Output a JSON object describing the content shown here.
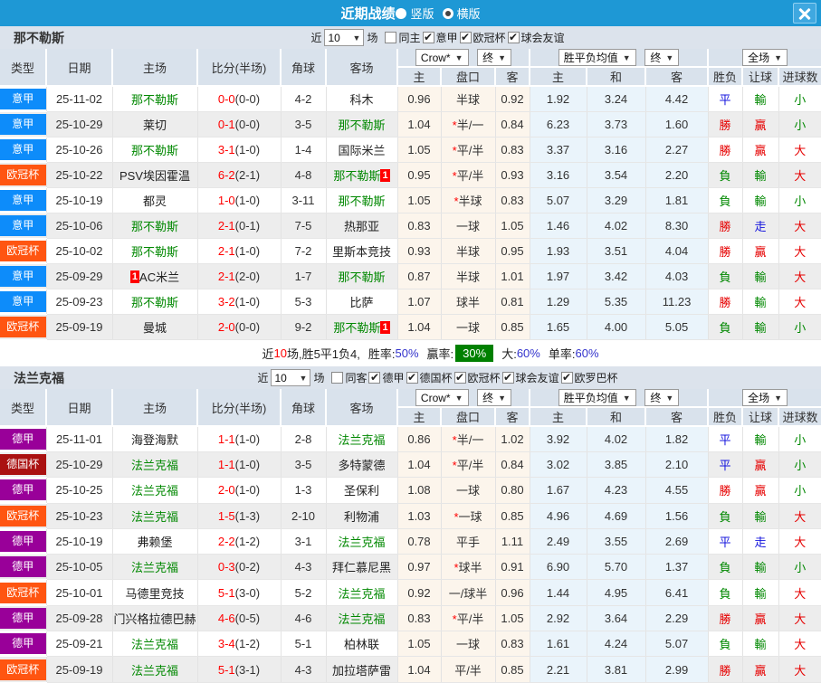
{
  "title_bar": {
    "title": "近期战绩",
    "layout_vertical": "竖版",
    "layout_horizontal": "横版",
    "selected_layout": "横版"
  },
  "columns": {
    "type": "类型",
    "date": "日期",
    "home": "主场",
    "score": "比分(半场)",
    "corner": "角球",
    "away": "客场",
    "asia_home": "主",
    "asia_pan": "盘口",
    "asia_away": "客",
    "eu_home": "主",
    "eu_draw": "和",
    "eu_away": "客",
    "res_wdl": "胜负",
    "res_pan": "让球",
    "res_goal": "进球数",
    "dd_crow": "Crow*",
    "dd_final": "终",
    "dd_avg": "胜平负均值",
    "dd_final2": "终",
    "dd_full": "全场"
  },
  "league_colors": {
    "意甲": "#0D8CFA",
    "欧冠杯": "#FF5511",
    "德甲": "#990099",
    "德国杯": "#AA1111"
  },
  "sections": [
    {
      "team": "那不勒斯",
      "filter": {
        "near": "近",
        "count": "10",
        "unit": "场",
        "same_label": "同主",
        "same_checked": false,
        "leagues": [
          "意甲",
          "欧冠杯",
          "球会友谊"
        ]
      },
      "rows": [
        {
          "league": "意甲",
          "date": "25-11-02",
          "home": "那不勒斯",
          "home_green": true,
          "home_badge": null,
          "score": "0-0",
          "half": "(0-0)",
          "corners": "4-2",
          "away": "科木",
          "away_green": false,
          "away_badge": null,
          "asia": [
            "0.96",
            "半球",
            "0.92"
          ],
          "asia_star": false,
          "europe": [
            "1.92",
            "3.24",
            "4.42"
          ],
          "results": [
            "平",
            "輸",
            "小"
          ]
        },
        {
          "league": "意甲",
          "date": "25-10-29",
          "home": "莱切",
          "home_green": false,
          "home_badge": null,
          "score": "0-1",
          "half": "(0-0)",
          "corners": "3-5",
          "away": "那不勒斯",
          "away_green": true,
          "away_badge": null,
          "asia": [
            "1.04",
            "半/一",
            "0.84"
          ],
          "asia_star": true,
          "europe": [
            "6.23",
            "3.73",
            "1.60"
          ],
          "results": [
            "勝",
            "贏",
            "小"
          ]
        },
        {
          "league": "意甲",
          "date": "25-10-26",
          "home": "那不勒斯",
          "home_green": true,
          "home_badge": null,
          "score": "3-1",
          "half": "(1-0)",
          "corners": "1-4",
          "away": "国际米兰",
          "away_green": false,
          "away_badge": null,
          "asia": [
            "1.05",
            "平/半",
            "0.83"
          ],
          "asia_star": true,
          "europe": [
            "3.37",
            "3.16",
            "2.27"
          ],
          "results": [
            "勝",
            "贏",
            "大"
          ]
        },
        {
          "league": "欧冠杯",
          "date": "25-10-22",
          "home": "PSV埃因霍温",
          "home_green": false,
          "home_badge": null,
          "score": "6-2",
          "half": "(2-1)",
          "corners": "4-8",
          "away": "那不勒斯",
          "away_green": true,
          "away_badge": {
            "text": "1",
            "pos": "after"
          },
          "asia": [
            "0.95",
            "平/半",
            "0.93"
          ],
          "asia_star": true,
          "europe": [
            "3.16",
            "3.54",
            "2.20"
          ],
          "results": [
            "負",
            "輸",
            "大"
          ]
        },
        {
          "league": "意甲",
          "date": "25-10-19",
          "home": "都灵",
          "home_green": false,
          "home_badge": null,
          "score": "1-0",
          "half": "(1-0)",
          "corners": "3-11",
          "away": "那不勒斯",
          "away_green": true,
          "away_badge": null,
          "asia": [
            "1.05",
            "半球",
            "0.83"
          ],
          "asia_star": true,
          "europe": [
            "5.07",
            "3.29",
            "1.81"
          ],
          "results": [
            "負",
            "輸",
            "小"
          ]
        },
        {
          "league": "意甲",
          "date": "25-10-06",
          "home": "那不勒斯",
          "home_green": true,
          "home_badge": null,
          "score": "2-1",
          "half": "(0-1)",
          "corners": "7-5",
          "away": "热那亚",
          "away_green": false,
          "away_badge": null,
          "asia": [
            "0.83",
            "一球",
            "1.05"
          ],
          "asia_star": false,
          "europe": [
            "1.46",
            "4.02",
            "8.30"
          ],
          "results": [
            "勝",
            "走",
            "大"
          ]
        },
        {
          "league": "欧冠杯",
          "date": "25-10-02",
          "home": "那不勒斯",
          "home_green": true,
          "home_badge": null,
          "score": "2-1",
          "half": "(1-0)",
          "corners": "7-2",
          "away": "里斯本竞技",
          "away_green": false,
          "away_badge": null,
          "asia": [
            "0.93",
            "半球",
            "0.95"
          ],
          "asia_star": false,
          "europe": [
            "1.93",
            "3.51",
            "4.04"
          ],
          "results": [
            "勝",
            "贏",
            "大"
          ]
        },
        {
          "league": "意甲",
          "date": "25-09-29",
          "home": "AC米兰",
          "home_green": false,
          "home_badge": {
            "text": "1",
            "pos": "before"
          },
          "score": "2-1",
          "half": "(2-0)",
          "corners": "1-7",
          "away": "那不勒斯",
          "away_green": true,
          "away_badge": null,
          "asia": [
            "0.87",
            "半球",
            "1.01"
          ],
          "asia_star": false,
          "europe": [
            "1.97",
            "3.42",
            "4.03"
          ],
          "results": [
            "負",
            "輸",
            "大"
          ]
        },
        {
          "league": "意甲",
          "date": "25-09-23",
          "home": "那不勒斯",
          "home_green": true,
          "home_badge": null,
          "score": "3-2",
          "half": "(1-0)",
          "corners": "5-3",
          "away": "比萨",
          "away_green": false,
          "away_badge": null,
          "asia": [
            "1.07",
            "球半",
            "0.81"
          ],
          "asia_star": false,
          "europe": [
            "1.29",
            "5.35",
            "11.23"
          ],
          "results": [
            "勝",
            "輸",
            "大"
          ]
        },
        {
          "league": "欧冠杯",
          "date": "25-09-19",
          "home": "曼城",
          "home_green": false,
          "home_badge": null,
          "score": "2-0",
          "half": "(0-0)",
          "corners": "9-2",
          "away": "那不勒斯",
          "away_green": true,
          "away_badge": {
            "text": "1",
            "pos": "after"
          },
          "asia": [
            "1.04",
            "一球",
            "0.85"
          ],
          "asia_star": false,
          "europe": [
            "1.65",
            "4.00",
            "5.05"
          ],
          "results": [
            "負",
            "輸",
            "小"
          ]
        }
      ],
      "summary": {
        "near": "近",
        "count": "10",
        "mid": "场,胜5平1负4,",
        "win_label": "胜率:",
        "win": "50%",
        "yl_label": "贏率:",
        "yl": "30%",
        "big_label": "大:",
        "big": "60%",
        "single_label": "单率:",
        "single": "60%"
      }
    },
    {
      "team": "法兰克福",
      "filter": {
        "near": "近",
        "count": "10",
        "unit": "场",
        "same_label": "同客",
        "same_checked": false,
        "leagues": [
          "德甲",
          "德国杯",
          "欧冠杯",
          "球会友谊",
          "欧罗巴杯"
        ]
      },
      "rows": [
        {
          "league": "德甲",
          "date": "25-11-01",
          "home": "海登海默",
          "home_green": false,
          "home_badge": null,
          "score": "1-1",
          "half": "(1-0)",
          "corners": "2-8",
          "away": "法兰克福",
          "away_green": true,
          "away_badge": null,
          "asia": [
            "0.86",
            "半/一",
            "1.02"
          ],
          "asia_star": true,
          "europe": [
            "3.92",
            "4.02",
            "1.82"
          ],
          "results": [
            "平",
            "輸",
            "小"
          ]
        },
        {
          "league": "德国杯",
          "date": "25-10-29",
          "home": "法兰克福",
          "home_green": true,
          "home_badge": null,
          "score": "1-1",
          "half": "(1-0)",
          "corners": "3-5",
          "away": "多特蒙德",
          "away_green": false,
          "away_badge": null,
          "asia": [
            "1.04",
            "平/半",
            "0.84"
          ],
          "asia_star": true,
          "europe": [
            "3.02",
            "3.85",
            "2.10"
          ],
          "results": [
            "平",
            "贏",
            "小"
          ]
        },
        {
          "league": "德甲",
          "date": "25-10-25",
          "home": "法兰克福",
          "home_green": true,
          "home_badge": null,
          "score": "2-0",
          "half": "(1-0)",
          "corners": "1-3",
          "away": "圣保利",
          "away_green": false,
          "away_badge": null,
          "asia": [
            "1.08",
            "一球",
            "0.80"
          ],
          "asia_star": false,
          "europe": [
            "1.67",
            "4.23",
            "4.55"
          ],
          "results": [
            "勝",
            "贏",
            "小"
          ]
        },
        {
          "league": "欧冠杯",
          "date": "25-10-23",
          "home": "法兰克福",
          "home_green": true,
          "home_badge": null,
          "score": "1-5",
          "half": "(1-3)",
          "corners": "2-10",
          "away": "利物浦",
          "away_green": false,
          "away_badge": null,
          "asia": [
            "1.03",
            "一球",
            "0.85"
          ],
          "asia_star": true,
          "europe": [
            "4.96",
            "4.69",
            "1.56"
          ],
          "results": [
            "負",
            "輸",
            "大"
          ]
        },
        {
          "league": "德甲",
          "date": "25-10-19",
          "home": "弗赖堡",
          "home_green": false,
          "home_badge": null,
          "score": "2-2",
          "half": "(1-2)",
          "corners": "3-1",
          "away": "法兰克福",
          "away_green": true,
          "away_badge": null,
          "asia": [
            "0.78",
            "平手",
            "1.11"
          ],
          "asia_star": false,
          "europe": [
            "2.49",
            "3.55",
            "2.69"
          ],
          "results": [
            "平",
            "走",
            "大"
          ]
        },
        {
          "league": "德甲",
          "date": "25-10-05",
          "home": "法兰克福",
          "home_green": true,
          "home_badge": null,
          "score": "0-3",
          "half": "(0-2)",
          "corners": "4-3",
          "away": "拜仁慕尼黑",
          "away_green": false,
          "away_badge": null,
          "asia": [
            "0.97",
            "球半",
            "0.91"
          ],
          "asia_star": true,
          "europe": [
            "6.90",
            "5.70",
            "1.37"
          ],
          "results": [
            "負",
            "輸",
            "小"
          ]
        },
        {
          "league": "欧冠杯",
          "date": "25-10-01",
          "home": "马德里竞技",
          "home_green": false,
          "home_badge": null,
          "score": "5-1",
          "half": "(3-0)",
          "corners": "5-2",
          "away": "法兰克福",
          "away_green": true,
          "away_badge": null,
          "asia": [
            "0.92",
            "一/球半",
            "0.96"
          ],
          "asia_star": false,
          "europe": [
            "1.44",
            "4.95",
            "6.41"
          ],
          "results": [
            "負",
            "輸",
            "大"
          ]
        },
        {
          "league": "德甲",
          "date": "25-09-28",
          "home": "门兴格拉德巴赫",
          "home_green": false,
          "home_badge": null,
          "score": "4-6",
          "half": "(0-5)",
          "corners": "4-6",
          "away": "法兰克福",
          "away_green": true,
          "away_badge": null,
          "asia": [
            "0.83",
            "平/半",
            "1.05"
          ],
          "asia_star": true,
          "europe": [
            "2.92",
            "3.64",
            "2.29"
          ],
          "results": [
            "勝",
            "贏",
            "大"
          ]
        },
        {
          "league": "德甲",
          "date": "25-09-21",
          "home": "法兰克福",
          "home_green": true,
          "home_badge": null,
          "score": "3-4",
          "half": "(1-2)",
          "corners": "5-1",
          "away": "柏林联",
          "away_green": false,
          "away_badge": null,
          "asia": [
            "1.05",
            "一球",
            "0.83"
          ],
          "asia_star": false,
          "europe": [
            "1.61",
            "4.24",
            "5.07"
          ],
          "results": [
            "負",
            "輸",
            "大"
          ]
        },
        {
          "league": "欧冠杯",
          "date": "25-09-19",
          "home": "法兰克福",
          "home_green": true,
          "home_badge": null,
          "score": "5-1",
          "half": "(3-1)",
          "corners": "4-3",
          "away": "加拉塔萨雷",
          "away_green": false,
          "away_badge": null,
          "asia": [
            "1.04",
            "平/半",
            "0.85"
          ],
          "asia_star": false,
          "europe": [
            "2.21",
            "3.81",
            "2.99"
          ],
          "results": [
            "勝",
            "贏",
            "大"
          ]
        }
      ],
      "summary": null
    }
  ]
}
